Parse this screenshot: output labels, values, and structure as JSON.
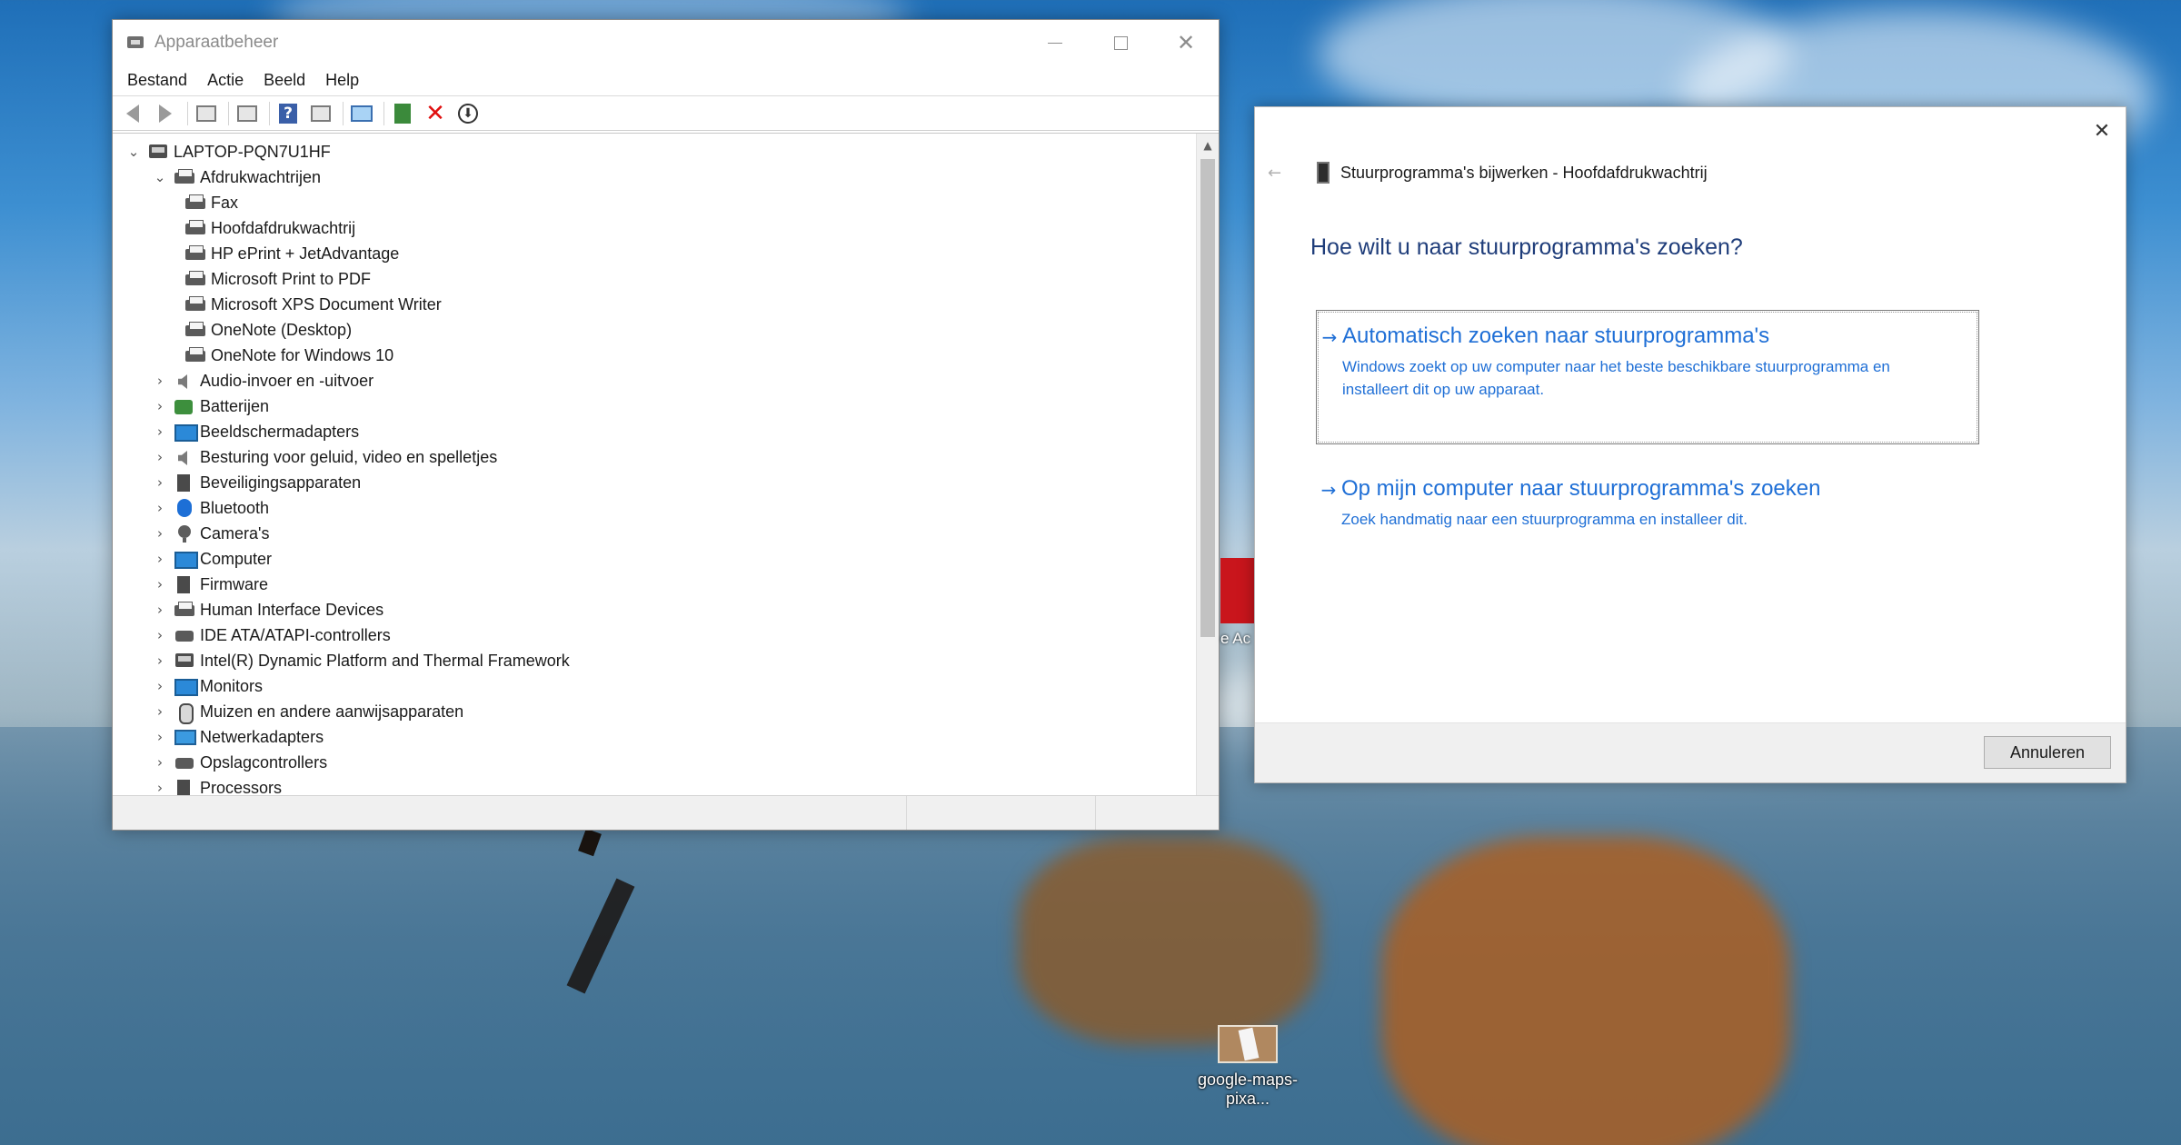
{
  "device_manager": {
    "title": "Apparaatbeheer",
    "menu": [
      "Bestand",
      "Actie",
      "Beeld",
      "Help"
    ],
    "tree": {
      "root": "LAPTOP-PQN7U1HF",
      "expanded_category": "Afdrukwachtrijen",
      "printers": [
        "Fax",
        "Hoofdafdrukwachtrij",
        "HP ePrint + JetAdvantage",
        "Microsoft Print to PDF",
        "Microsoft XPS Document Writer",
        "OneNote (Desktop)",
        "OneNote for Windows 10"
      ],
      "categories": [
        {
          "label": "Audio-invoer en -uitvoer",
          "icon": "speaker-icon"
        },
        {
          "label": "Batterijen",
          "icon": "battery-icon"
        },
        {
          "label": "Beeldschermadapters",
          "icon": "display-adapter-icon"
        },
        {
          "label": "Besturing voor geluid, video en spelletjes",
          "icon": "speaker-icon"
        },
        {
          "label": "Beveiligingsapparaten",
          "icon": "security-device-icon"
        },
        {
          "label": "Bluetooth",
          "icon": "bluetooth-icon"
        },
        {
          "label": "Camera's",
          "icon": "camera-icon"
        },
        {
          "label": "Computer",
          "icon": "computer-icon"
        },
        {
          "label": "Firmware",
          "icon": "firmware-icon"
        },
        {
          "label": "Human Interface Devices",
          "icon": "hid-icon"
        },
        {
          "label": "IDE ATA/ATAPI-controllers",
          "icon": "ide-controller-icon"
        },
        {
          "label": "Intel(R) Dynamic Platform and Thermal Framework",
          "icon": "intel-device-icon"
        },
        {
          "label": "Monitors",
          "icon": "monitor-icon"
        },
        {
          "label": "Muizen en andere aanwijsapparaten",
          "icon": "mouse-icon"
        },
        {
          "label": "Netwerkadapters",
          "icon": "network-adapter-icon"
        },
        {
          "label": "Opslagcontrollers",
          "icon": "storage-controller-icon"
        },
        {
          "label": "Processors",
          "icon": "processor-icon"
        }
      ]
    }
  },
  "update_driver": {
    "header": "Stuurprogramma's bijwerken - Hoofdafdrukwachtrij",
    "question": "Hoe wilt u naar stuurprogramma's zoeken?",
    "option_auto": {
      "title": "Automatisch zoeken naar stuurprogramma's",
      "description": "Windows zoekt op uw computer naar het beste beschikbare stuurprogramma en installeert dit op uw apparaat."
    },
    "option_manual": {
      "title": "Op mijn computer naar stuurprogramma's zoeken",
      "description": "Zoek handmatig naar een stuurprogramma en installeer dit."
    },
    "cancel_label": "Annuleren",
    "accent_color": "#1f6fd6"
  },
  "desktop": {
    "pdf_shortcut_label": "e Ac",
    "file_label": "google-maps-pixa..."
  }
}
